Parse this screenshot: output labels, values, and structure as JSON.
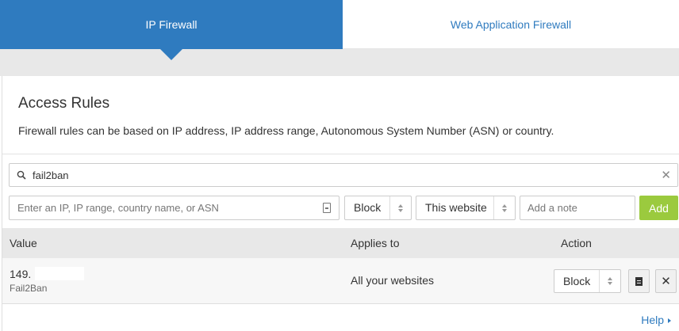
{
  "tabs": [
    {
      "label": "IP Firewall",
      "active": true
    },
    {
      "label": "Web Application Firewall",
      "active": false
    }
  ],
  "section": {
    "title": "Access Rules",
    "description": "Firewall rules can be based on IP address, IP address range, Autonomous System Number (ASN) or country."
  },
  "search": {
    "value": "fail2ban",
    "icon": "search-icon",
    "clear_icon": "close-icon",
    "clear_glyph": "✕"
  },
  "add_rule": {
    "ip_placeholder": "Enter an IP, IP range, country name, or ASN",
    "mode": "Block",
    "scope": "This website",
    "note_placeholder": "Add a note",
    "add_label": "Add"
  },
  "table": {
    "columns": [
      "Value",
      "Applies to",
      "Action"
    ],
    "rows": [
      {
        "value": "149.",
        "note": "Fail2Ban",
        "applies_to": "All your websites",
        "action": "Block"
      }
    ]
  },
  "help": {
    "label": "Help"
  },
  "colors": {
    "accent": "#2f7bbf",
    "add_button": "#9bca3e",
    "band": "#e8e8e8"
  }
}
